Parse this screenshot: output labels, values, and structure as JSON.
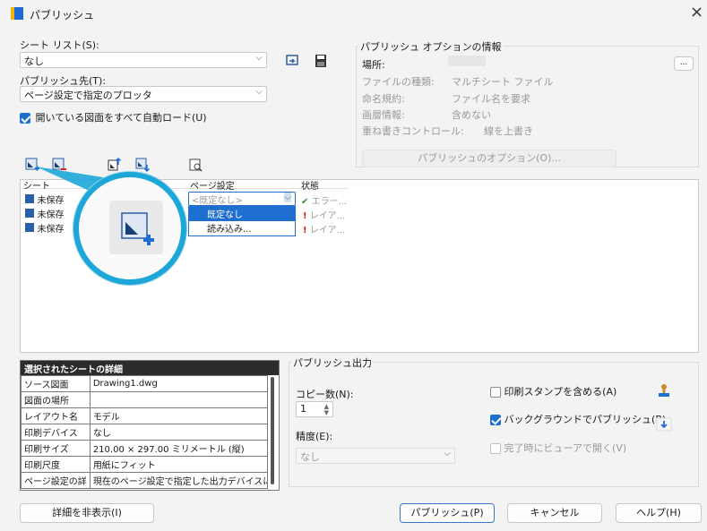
{
  "window": {
    "title": "パブリッシュ",
    "close_glyph": "×"
  },
  "sheet_list": {
    "label": "シート リスト(S):",
    "value": "なし"
  },
  "publish_to": {
    "label": "パブリッシュ先(T):",
    "value": "ページ設定で指定のプロッタ"
  },
  "autoload": {
    "label": "開いている図面をすべて自動ロード(U)",
    "checked": true
  },
  "options_info": {
    "title": "パブリッシュ オプションの情報",
    "location_label": "場所:",
    "browse_label": "...",
    "rows": [
      {
        "label": "ファイルの種類:",
        "value": "マルチシート ファイル"
      },
      {
        "label": "命名規約:",
        "value": "ファイル名を要求"
      },
      {
        "label": "画層情報:",
        "value": "含めない"
      },
      {
        "label": "重ね書きコントロール:",
        "value": "線を上書き"
      }
    ],
    "options_button": "パブリッシュのオプション(O)..."
  },
  "sheet_table": {
    "columns": [
      "シート",
      "ページ設定",
      "状態"
    ],
    "rows": [
      {
        "name": "未保存",
        "page_setup": "<既定なし>",
        "status": "エラー..."
      },
      {
        "name": "未保存",
        "page_setup": "",
        "status": "レイア..."
      },
      {
        "name": "未保存",
        "page_setup": "",
        "status": "レイア..."
      }
    ],
    "dropdown_options": [
      "既定なし",
      "読み込み..."
    ]
  },
  "details": {
    "header": "選択されたシートの詳細",
    "rows": [
      {
        "label": "ソース図面",
        "value": "Drawing1.dwg"
      },
      {
        "label": "図面の場所",
        "value": ""
      },
      {
        "label": "レイアウト名",
        "value": "モデル"
      },
      {
        "label": "印刷デバイス",
        "value": "なし"
      },
      {
        "label": "印刷サイズ",
        "value": "210.00 × 297.00 ミリメートル (縦)"
      },
      {
        "label": "印刷尺度",
        "value": "用紙にフィット"
      },
      {
        "label": "ページ設定の詳",
        "value": "現在のページ設定で指定した出力デバイスに"
      }
    ]
  },
  "publish_output": {
    "title": "パブリッシュ出力",
    "copies_label": "コピー数(N):",
    "copies_value": "1",
    "precision_label": "精度(E):",
    "precision_value": "なし",
    "include_stamp": {
      "label": "印刷スタンプを含める(A)",
      "checked": false
    },
    "background": {
      "label": "バックグラウンドでパブリッシュ(B)",
      "checked": true
    },
    "open_viewer": {
      "label": "完了時にビューアで開く(V)",
      "checked": false
    }
  },
  "buttons": {
    "hide_details": "詳細を非表示(I)",
    "publish": "パブリッシュ(P)",
    "cancel": "キャンセル",
    "help": "ヘルプ(H)"
  },
  "colors": {
    "accent": "#1f6fd1",
    "magnifier_ring": "#1da7d8",
    "error": "#d91c1c",
    "ok": "#2e8b3a"
  }
}
